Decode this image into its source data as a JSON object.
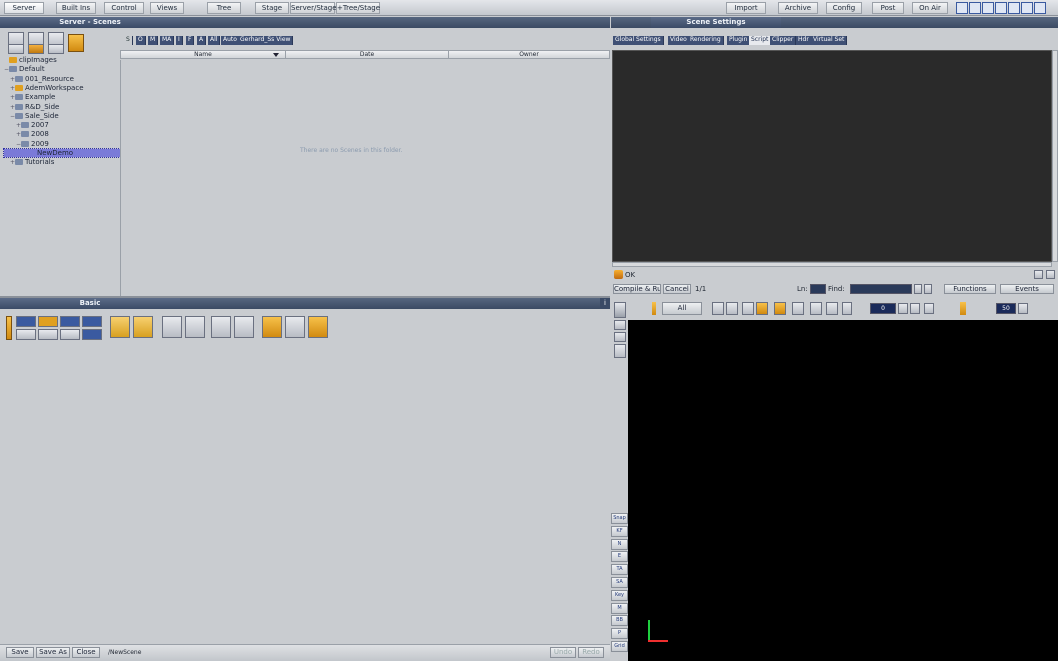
{
  "topbar": {
    "left_buttons": [
      "Server",
      "Built Ins",
      "Control",
      "Views",
      "Tree",
      "Stage",
      "Server/Stage",
      "+Tree/Stage"
    ],
    "right_buttons": [
      "Import",
      "Archive",
      "Config",
      "Post",
      "On Air"
    ]
  },
  "server_panel": {
    "title": "Server - Scenes",
    "tree": [
      {
        "label": "clipImages",
        "indent": 0,
        "toggle": ""
      },
      {
        "label": "Default",
        "indent": 0,
        "toggle": "−"
      },
      {
        "label": "001_Resource",
        "indent": 1,
        "toggle": "+"
      },
      {
        "label": "AdemWorkspace",
        "indent": 1,
        "toggle": "+"
      },
      {
        "label": "Example",
        "indent": 1,
        "toggle": "+"
      },
      {
        "label": "R&D_Side",
        "indent": 1,
        "toggle": "+"
      },
      {
        "label": "Sale_Side",
        "indent": 1,
        "toggle": "−"
      },
      {
        "label": "2007",
        "indent": 2,
        "toggle": "+"
      },
      {
        "label": "2008",
        "indent": 2,
        "toggle": "+"
      },
      {
        "label": "2009",
        "indent": 2,
        "toggle": "−"
      },
      {
        "label": "NewDemo",
        "indent": 3,
        "toggle": ""
      },
      {
        "label": "Tutorials",
        "indent": 1,
        "toggle": "+"
      }
    ],
    "filter_tabs": [
      "S",
      "O",
      "M",
      "MA",
      "I",
      "F",
      "A",
      "All",
      "Auto",
      "Gerhard_Ss View"
    ],
    "columns": [
      "Name",
      "Date",
      "Owner"
    ],
    "empty_message": "There are no Scenes in this folder."
  },
  "scene_settings": {
    "title": "Scene Settings",
    "tabs": [
      "Global Settings",
      "Video",
      "Rendering",
      "Plugin",
      "Script",
      "Clipper",
      "Hdr",
      "Virtual Set"
    ],
    "status": "OK",
    "compile_label": "Compile & Run",
    "cancel_label": "Cancel",
    "page": "1/1",
    "line_label": "Ln:",
    "find_label": "Find:",
    "functions_label": "Functions",
    "events_label": "Events"
  },
  "basic_panel": {
    "title": "Basic",
    "info": "i"
  },
  "stage_controls": {
    "all_label": "All",
    "frame_value": "0",
    "fps_value": "50"
  },
  "side_buttons": [
    "Snap",
    "KF",
    "N",
    "E",
    "TA",
    "SA",
    "Key",
    "M",
    "BB",
    "P",
    "Grid"
  ],
  "bottom_bar": {
    "save_label": "Save",
    "save_as_label": "Save As",
    "close_label": "Close",
    "scene_path": "/NewScene",
    "undo_label": "Undo",
    "redo_label": "Redo"
  },
  "colors": {
    "panel_header": "#4a5a78",
    "workspace": "#c9ccd0",
    "editor": "#2a2a2a",
    "viewport": "#000000"
  }
}
